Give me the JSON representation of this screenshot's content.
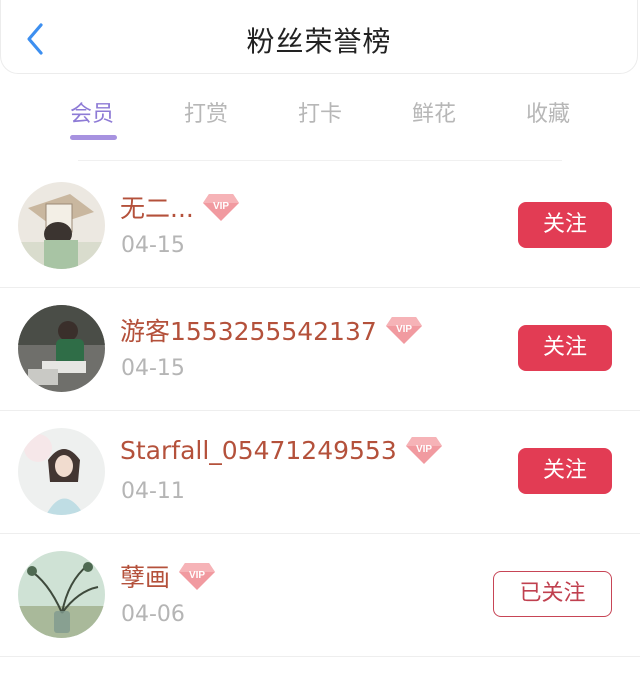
{
  "header": {
    "title": "粉丝荣誉榜",
    "back_icon": "chevron-left-icon"
  },
  "tabs": [
    {
      "label": "会员",
      "active": true
    },
    {
      "label": "打赏",
      "active": false
    },
    {
      "label": "打卡",
      "active": false
    },
    {
      "label": "鲜花",
      "active": false
    },
    {
      "label": "收藏",
      "active": false
    }
  ],
  "colors": {
    "accent_tab": "#8e7bd6",
    "name_color": "#b4513b",
    "follow_button": "#e23c54"
  },
  "fans": [
    {
      "name": "无二...",
      "badge": "VIP",
      "date": "04-15",
      "action": "关注",
      "followed": false
    },
    {
      "name": "游客1553255542137",
      "badge": "VIP",
      "date": "04-15",
      "action": "关注",
      "followed": false
    },
    {
      "name": "Starfall_05471249553",
      "badge": "VIP",
      "date": "04-11",
      "action": "关注",
      "followed": false
    },
    {
      "name": "孽画",
      "badge": "VIP",
      "date": "04-06",
      "action": "已关注",
      "followed": true
    }
  ]
}
